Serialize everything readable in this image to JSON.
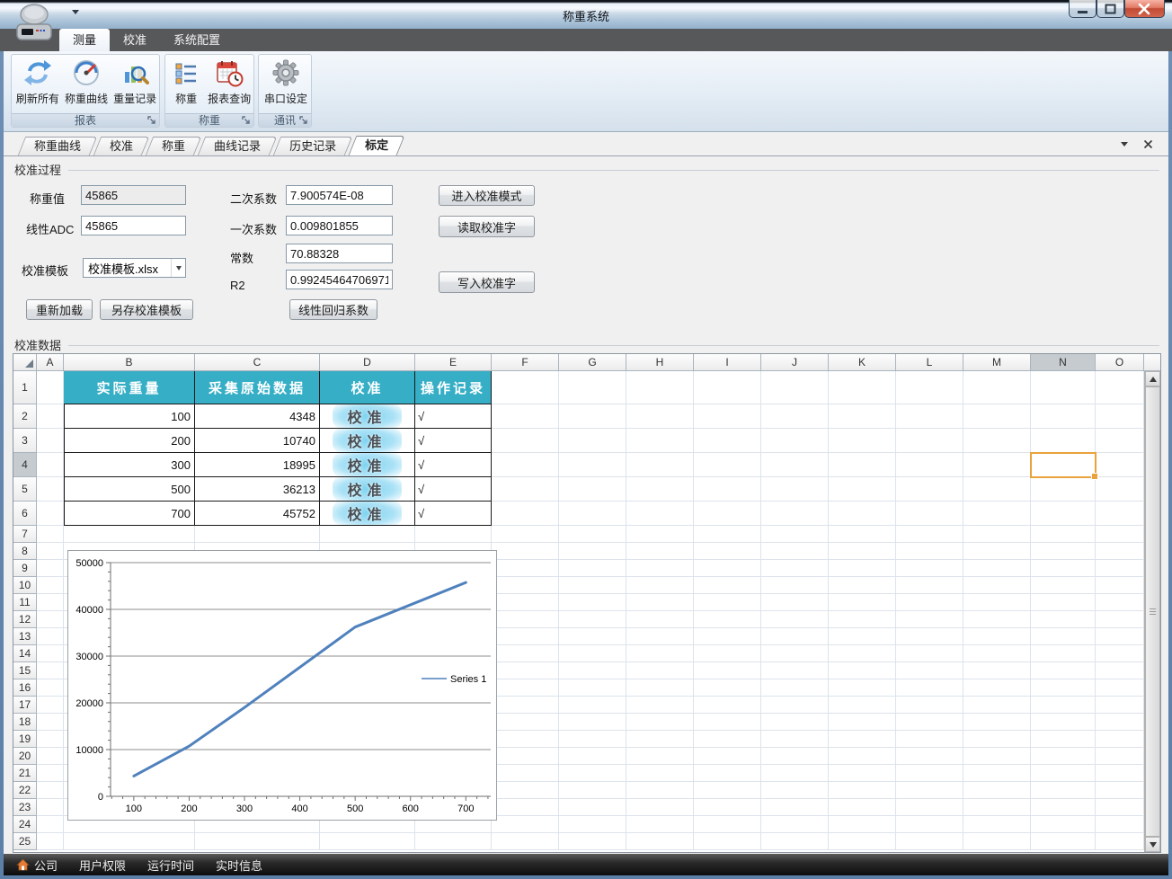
{
  "window": {
    "title": "称重系统",
    "caption_buttons": {
      "minimize": "minimize",
      "maximize": "maximize",
      "close": "close"
    }
  },
  "ribbon": {
    "tabs": [
      {
        "name": "measure",
        "label": "测量",
        "active": true
      },
      {
        "name": "calibrate",
        "label": "校准",
        "active": false
      },
      {
        "name": "system-config",
        "label": "系统配置",
        "active": false
      }
    ],
    "groups": [
      {
        "name": "report",
        "label": "报表",
        "buttons": [
          {
            "name": "refresh-all",
            "label": "刷新所有",
            "icon": "refresh-icon"
          },
          {
            "name": "weigh-curve",
            "label": "称重曲线",
            "icon": "gauge-icon"
          },
          {
            "name": "weight-records",
            "label": "重量记录",
            "icon": "chart-search-icon"
          }
        ]
      },
      {
        "name": "weighing",
        "label": "称重",
        "buttons": [
          {
            "name": "weigh",
            "label": "称重",
            "icon": "list-icon"
          },
          {
            "name": "report-query",
            "label": "报表查询",
            "icon": "calendar-clock-icon"
          }
        ]
      },
      {
        "name": "comm",
        "label": "通讯",
        "buttons": [
          {
            "name": "serial-port-setup",
            "label": "串口设定",
            "icon": "gear-icon"
          }
        ]
      }
    ]
  },
  "doc_tabs": {
    "items": [
      {
        "name": "weigh-curve",
        "label": "称重曲线",
        "active": false
      },
      {
        "name": "calibration",
        "label": "校准",
        "active": false
      },
      {
        "name": "weighing",
        "label": "称重",
        "active": false
      },
      {
        "name": "curve-records",
        "label": "曲线记录",
        "active": false
      },
      {
        "name": "history-records",
        "label": "历史记录",
        "active": false
      },
      {
        "name": "scaling",
        "label": "标定",
        "active": true
      }
    ]
  },
  "calibration_process": {
    "group_label": "校准过程",
    "fields": {
      "weigh_value": {
        "label": "称重值",
        "value": "45865"
      },
      "linear_adc": {
        "label": "线性ADC",
        "value": "45865"
      },
      "template": {
        "label": "校准模板",
        "value": "校准模板.xlsx"
      },
      "quadratic": {
        "label": "二次系数",
        "value": "7.900574E-08"
      },
      "linear": {
        "label": "一次系数",
        "value": "0.009801855"
      },
      "constant": {
        "label": "常数",
        "value": "70.88328"
      },
      "r2": {
        "label": "R2",
        "value": "0.99245464706971"
      }
    },
    "buttons": {
      "reload": "重新加载",
      "save_as": "另存校准模板",
      "regression": "线性回归系数",
      "enter_mode": "进入校准模式",
      "read_word": "读取校准字",
      "write_word": "写入校准字"
    }
  },
  "calibration_data": {
    "group_label": "校准数据",
    "grid": {
      "columns": [
        "A",
        "B",
        "C",
        "D",
        "E",
        "F",
        "G",
        "H",
        "I",
        "J",
        "K",
        "L",
        "M",
        "N",
        "O"
      ],
      "row_count": 25,
      "selection": {
        "column": "N",
        "row": 4
      },
      "header_row": {
        "B": "实际重量",
        "C": "采集原始数据",
        "D": "校准",
        "E": "操作记录"
      },
      "rows": [
        {
          "row": 2,
          "weight": "100",
          "raw": "4348",
          "action": "校准",
          "record": "√"
        },
        {
          "row": 3,
          "weight": "200",
          "raw": "10740",
          "action": "校准",
          "record": "√"
        },
        {
          "row": 4,
          "weight": "300",
          "raw": "18995",
          "action": "校准",
          "record": "√"
        },
        {
          "row": 5,
          "weight": "500",
          "raw": "36213",
          "action": "校准",
          "record": "√"
        },
        {
          "row": 6,
          "weight": "700",
          "raw": "45752",
          "action": "校准",
          "record": "√"
        }
      ]
    }
  },
  "chart_data": {
    "type": "line",
    "x": [
      100,
      200,
      300,
      500,
      700
    ],
    "series": [
      {
        "name": "Series 1",
        "values": [
          4348,
          10740,
          18995,
          36213,
          45752
        ]
      }
    ],
    "title": "",
    "xlabel": "",
    "ylabel": "",
    "x_ticks": [
      100,
      200,
      300,
      400,
      500,
      600,
      700
    ],
    "y_ticks": [
      0,
      10000,
      20000,
      30000,
      40000,
      50000
    ],
    "x_axis_range": [
      58,
      745
    ],
    "ylim": [
      0,
      50000
    ],
    "x_major_step": 100,
    "x_minor_step": 20,
    "y_major_step": 10000,
    "y_minor_step": 2000,
    "grid": "horizontal",
    "legend_position": "right-middle",
    "line_color": "#4f81bd"
  },
  "status_bar": {
    "items": [
      {
        "name": "company",
        "label": "公司",
        "icon": "home-icon"
      },
      {
        "name": "user-rights",
        "label": "用户权限"
      },
      {
        "name": "run-time",
        "label": "运行时间"
      },
      {
        "name": "realtime-info",
        "label": "实时信息"
      }
    ]
  }
}
